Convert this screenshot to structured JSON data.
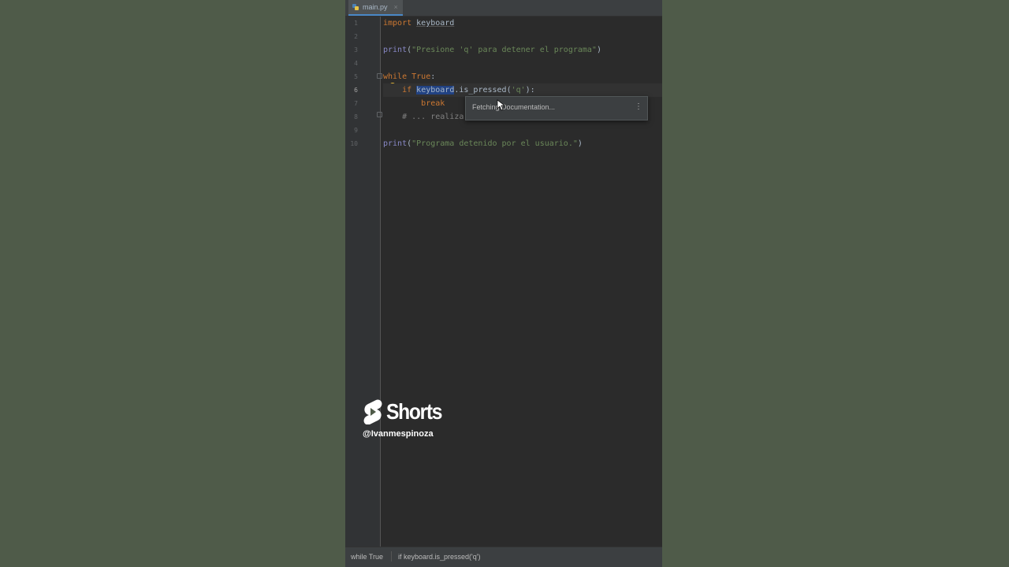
{
  "tab": {
    "filename": "main.py",
    "close": "×"
  },
  "lines": [
    "1",
    "2",
    "3",
    "4",
    "5",
    "6",
    "7",
    "8",
    "9",
    "10"
  ],
  "code": {
    "l1_kw": "import",
    "l1_mod": "keyboard",
    "l3_fn": "print",
    "l3_open": "(",
    "l3_str": "\"Presione 'q' para detener el programa\"",
    "l3_close": ")",
    "l5_kw": "while",
    "l5_true": "True",
    "l5_colon": ":",
    "l6_kw": "if",
    "l6_sel": "keyboard",
    "l6_rest": ".is_pressed(",
    "l6_str": "'q'",
    "l6_end": "):",
    "l7_kw": "break",
    "l8_cmt": "# ... realiza",
    "l10_fn": "print",
    "l10_open": "(",
    "l10_str": "\"Programa detenido por el usuario.\"",
    "l10_close": ")"
  },
  "popup": {
    "text": "Fetching Documentation...",
    "more": "⋮"
  },
  "statusbar": {
    "crumb1": "while True",
    "crumb2": "if keyboard.is_pressed('q')"
  },
  "shorts": {
    "word": "Shorts",
    "handle": "@Ivanmespinoza"
  },
  "colors": {
    "accent": "#4a88c7",
    "keyword": "#cc7832",
    "string": "#6a8759",
    "background": "#2b2b2b",
    "page": "#4f5b49"
  }
}
